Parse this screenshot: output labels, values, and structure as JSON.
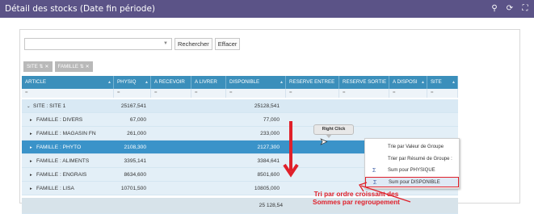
{
  "window": {
    "title": "Détail des stocks (Date fin période)",
    "icons": [
      "hierarchy-icon",
      "refresh-icon",
      "expand-icon"
    ]
  },
  "search": {
    "value": "",
    "search_label": "Rechercher",
    "clear_label": "Effacer"
  },
  "group_chips": [
    "SITE",
    "FAMILLE"
  ],
  "table": {
    "columns": [
      "ARTICLE",
      "PHYSIQ",
      "A RECEVOIR",
      "A LIVRER",
      "DISPONIBLE",
      "RESERVE ENTREE",
      "RESERVE SORTIE",
      "A DISPOSI",
      "SITE"
    ],
    "filter_placeholder": "=",
    "rows": [
      {
        "label": "SITE : SITE 1",
        "physique": "25167,541",
        "disponible": "25128,541",
        "kind": "group"
      },
      {
        "label": "FAMILLE : DIVERS",
        "physique": "67,000",
        "disponible": "77,000",
        "kind": "sub"
      },
      {
        "label": "FAMILLE : MAGASIN FN",
        "physique": "261,000",
        "disponible": "233,000",
        "kind": "sub"
      },
      {
        "label": "FAMILLE : PHYTO",
        "physique": "2108,300",
        "disponible": "2127,300",
        "kind": "selected"
      },
      {
        "label": "FAMILLE : ALIMENTS",
        "physique": "3395,141",
        "disponible": "3384,641",
        "kind": "sub"
      },
      {
        "label": "FAMILLE : ENGRAIS",
        "physique": "8634,600",
        "disponible": "8501,600",
        "kind": "sub"
      },
      {
        "label": "FAMILLE : LISA",
        "physique": "10701,500",
        "disponible": "10805,000",
        "kind": "sub"
      }
    ],
    "total_disponible": "25 128,54"
  },
  "context_menu": {
    "items": [
      "Trie par Valeur de Groupe",
      "Trier par Résumé de Groupe :",
      "Sum pour PHYSIQUE",
      "Sum pour DISPONIBLE"
    ]
  },
  "callout": {
    "text": "Right Click"
  },
  "annotation": {
    "line1": "Tri par ordre croissant des",
    "line2": "Sommes par regroupement"
  },
  "colors": {
    "titlebar": "#5b5387",
    "header": "#3b8fbb",
    "selected_row": "#3a93c9",
    "annotation": "#e0202a"
  }
}
